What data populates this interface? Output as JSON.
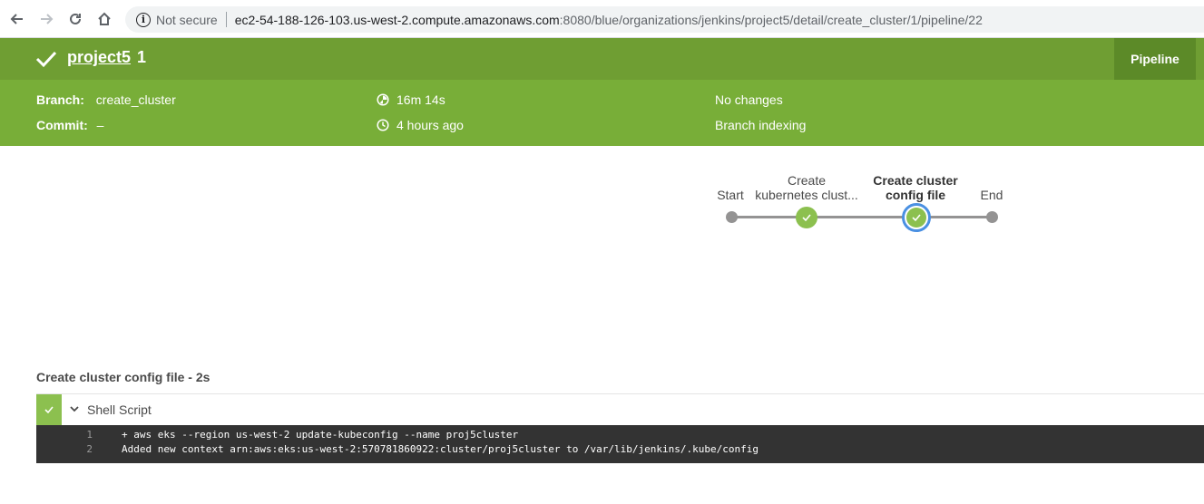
{
  "browser": {
    "back_icon": "arrow-left-icon",
    "forward_icon": "arrow-right-icon",
    "reload_icon": "reload-icon",
    "home_icon": "home-icon",
    "security_label": "Not secure",
    "url_host": "ec2-54-188-126-103.us-west-2.compute.amazonaws.com",
    "url_rest": ":8080/blue/organizations/jenkins/project5/detail/create_cluster/1/pipeline/22"
  },
  "header": {
    "project_name": "project5",
    "run_number": "1",
    "tab_label": "Pipeline",
    "status_color": "#6f9e33"
  },
  "meta": {
    "branch_label": "Branch:",
    "branch_value": "create_cluster",
    "commit_label": "Commit:",
    "commit_value": "–",
    "duration": "16m 14s",
    "started": "4 hours ago",
    "changes": "No changes",
    "cause": "Branch indexing"
  },
  "pipeline": {
    "stages": [
      {
        "label_line1": "",
        "label_line2": "Start",
        "status": "none"
      },
      {
        "label_line1": "Create",
        "label_line2": "kubernetes clust...",
        "status": "success"
      },
      {
        "label_line1": "Create cluster",
        "label_line2": "config file",
        "status": "success",
        "selected": true
      },
      {
        "label_line1": "",
        "label_line2": "End",
        "status": "none"
      }
    ]
  },
  "steps": {
    "title": "Create cluster config file - 2s",
    "items": [
      {
        "name": "Shell Script",
        "status": "success",
        "log": [
          {
            "num": "1",
            "text": "+ aws eks --region us-west-2 update-kubeconfig --name proj5cluster"
          },
          {
            "num": "2",
            "text": "Added new context arn:aws:eks:us-west-2:570781860922:cluster/proj5cluster to /var/lib/jenkins/.kube/config"
          }
        ]
      }
    ]
  },
  "colors": {
    "success": "#8cc04f",
    "selected_ring": "#4a90e2",
    "meta_bg": "#78ae38",
    "log_bg": "#333333"
  }
}
